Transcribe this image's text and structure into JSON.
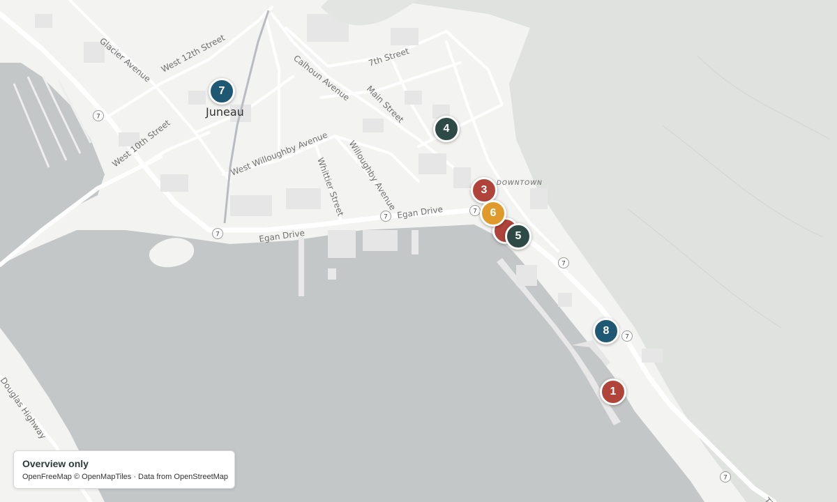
{
  "map": {
    "city_label": "Juneau",
    "district_label": "DOWNTOWN",
    "streets": {
      "west_12th": "West 12th Street",
      "glacier": "Glacier Avenue",
      "west_10th": "West 10th Street",
      "seventh": "7th Street",
      "calhoun": "Calhoun Avenue",
      "main": "Main Street",
      "west_willoughby": "West Willoughby Avenue",
      "whittier": "Whittier Street",
      "willoughby": "Willoughby Avenue",
      "egan_1": "Egan Drive",
      "egan_2": "Egan Drive",
      "douglas_hwy": "Douglas Highway",
      "thane": "Th"
    },
    "route_shield": "7"
  },
  "markers": [
    {
      "label": "7",
      "color": "#1f5873"
    },
    {
      "label": "4",
      "color": "#2d4a46"
    },
    {
      "label": "3",
      "color": "#b0433a"
    },
    {
      "label": "6",
      "color": "#e09a2b"
    },
    {
      "label": "5",
      "color": "#2d4a46"
    },
    {
      "label": "8",
      "color": "#1f5873"
    },
    {
      "label": "1",
      "color": "#b0433a"
    }
  ],
  "legend": {
    "title": "Overview only",
    "attribution": "OpenFreeMap © OpenMapTiles · Data from OpenStreetMap"
  }
}
